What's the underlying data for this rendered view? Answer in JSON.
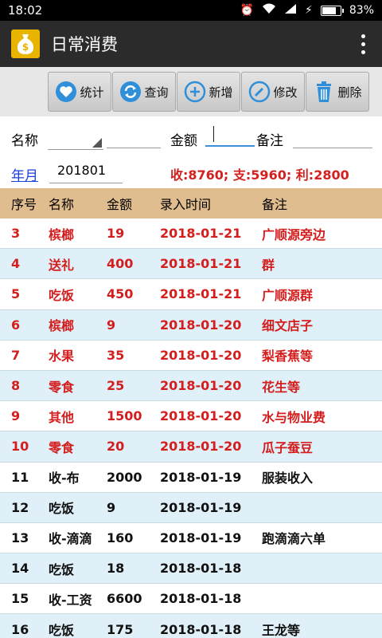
{
  "status": {
    "time": "18:02",
    "battery": "83%",
    "battery_level": 0.83
  },
  "app": {
    "title": "日常消费"
  },
  "toolbar": {
    "stats_label": "统计",
    "query_label": "查询",
    "add_label": "新增",
    "edit_label": "修改",
    "delete_label": "删除"
  },
  "form": {
    "name_label": "名称",
    "amount_label": "金额",
    "note_label": "备注",
    "month_link": "年月",
    "month_value": "201801",
    "summary": "收:8760; 支:5960; 利:2800"
  },
  "table": {
    "headers": [
      "序号",
      "名称",
      "金额",
      "录入时间",
      "备注"
    ],
    "rows": [
      [
        "3",
        "槟榔",
        "19",
        "2018-01-21",
        "广顺源旁边"
      ],
      [
        "4",
        "送礼",
        "400",
        "2018-01-21",
        "群"
      ],
      [
        "5",
        "吃饭",
        "450",
        "2018-01-21",
        "广顺源群"
      ],
      [
        "6",
        "槟榔",
        "9",
        "2018-01-20",
        "细文店子"
      ],
      [
        "7",
        "水果",
        "35",
        "2018-01-20",
        "梨香蕉等"
      ],
      [
        "8",
        "零食",
        "25",
        "2018-01-20",
        "花生等"
      ],
      [
        "9",
        "其他",
        "1500",
        "2018-01-20",
        "水与物业费"
      ],
      [
        "10",
        "零食",
        "20",
        "2018-01-20",
        "瓜子蚕豆"
      ],
      [
        "11",
        "收-布",
        "2000",
        "2018-01-19",
        "服装收入"
      ],
      [
        "12",
        "吃饭",
        "9",
        "2018-01-19",
        ""
      ],
      [
        "13",
        "收-滴滴",
        "160",
        "2018-01-19",
        "跑滴滴六单"
      ],
      [
        "14",
        "吃饭",
        "18",
        "2018-01-18",
        ""
      ],
      [
        "15",
        "收-工资",
        "6600",
        "2018-01-18",
        ""
      ],
      [
        "16",
        "吃饭",
        "175",
        "2018-01-18",
        "王龙等"
      ]
    ]
  },
  "colors": {
    "expense": "#d41e1e",
    "income": "#111111",
    "header_bg": "#e0bd8e",
    "alt_row": "#dff0f8",
    "logo": "#e8b400"
  }
}
